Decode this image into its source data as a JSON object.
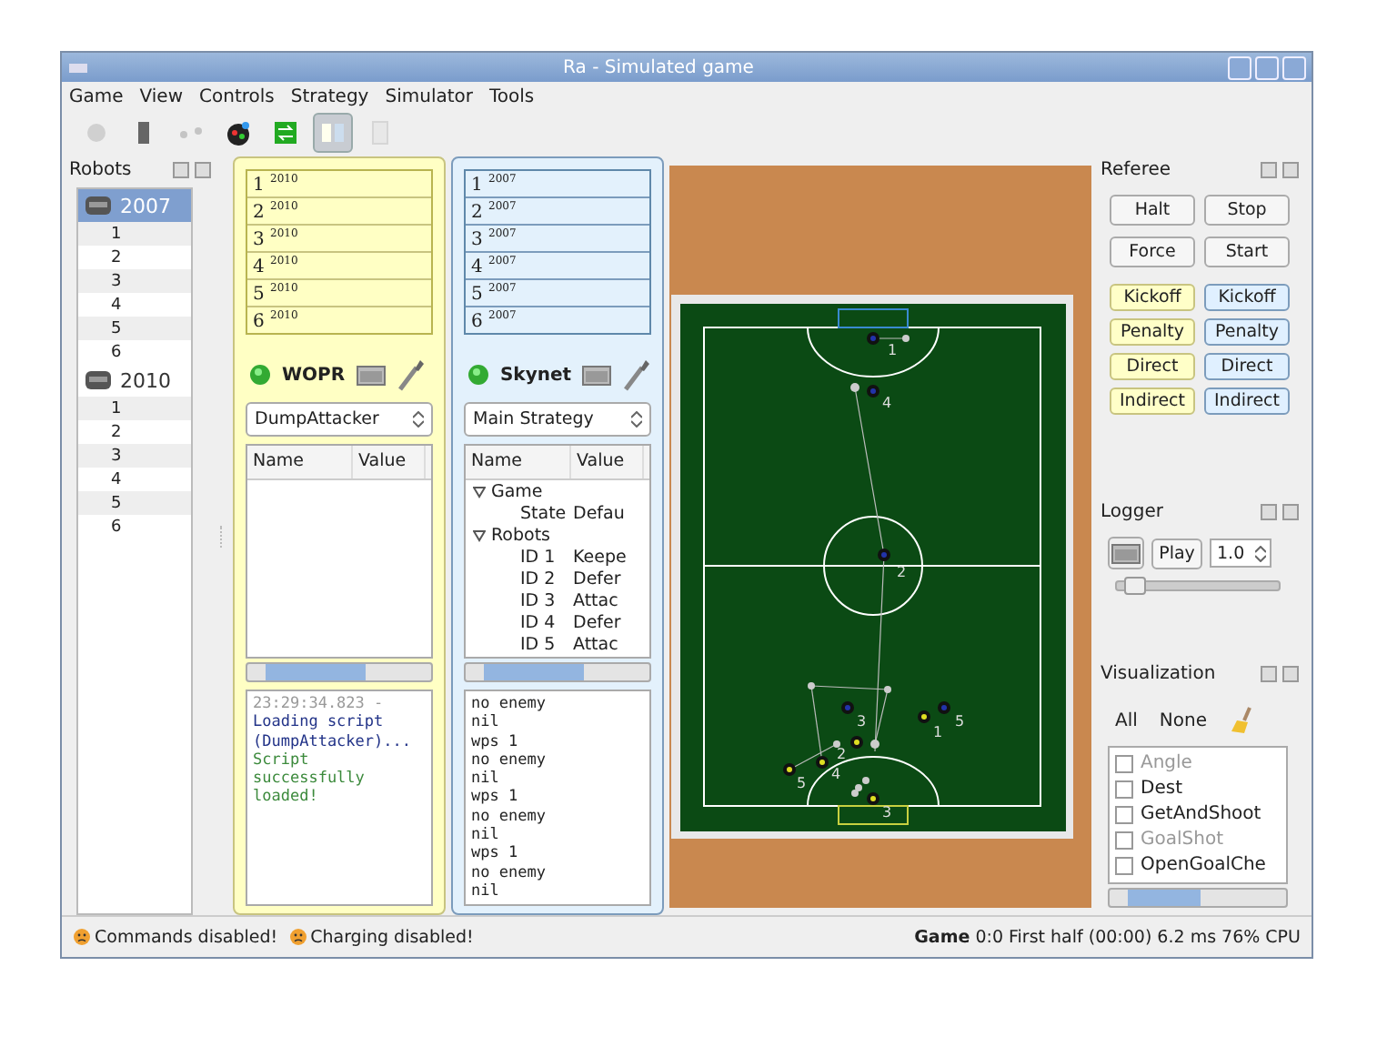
{
  "window": {
    "title": "Ra - Simulated game"
  },
  "menu": [
    {
      "label": "Game"
    },
    {
      "label": "View"
    },
    {
      "label": "Controls"
    },
    {
      "label": "Strategy"
    },
    {
      "label": "Simulator"
    },
    {
      "label": "Tools"
    }
  ],
  "toolbar": [
    {
      "kind": "camera",
      "disabled": true,
      "selected": false
    },
    {
      "kind": "battery",
      "disabled": false,
      "selected": false
    },
    {
      "kind": "network",
      "disabled": true,
      "selected": false
    },
    {
      "kind": "ball",
      "disabled": false,
      "selected": false
    },
    {
      "kind": "swap",
      "disabled": false,
      "selected": false
    },
    {
      "kind": "split",
      "disabled": false,
      "selected": true
    },
    {
      "kind": "page",
      "disabled": true,
      "selected": false
    }
  ],
  "robots_panel": {
    "title": "Robots",
    "groups": [
      {
        "label": "2007",
        "selected": true,
        "robots": [
          "1",
          "2",
          "3",
          "4",
          "5",
          "6"
        ]
      },
      {
        "label": "2010",
        "selected": false,
        "robots": [
          "1",
          "2",
          "3",
          "4",
          "5",
          "6"
        ]
      }
    ]
  },
  "teams": [
    {
      "kind": "yellow",
      "robots": [
        "1 $^{2010}$",
        "2 $^{2010}$",
        "3 $^{2010}$",
        "4 $^{2010}$",
        "5 $^{2010}$",
        "6 $^{2010}$"
      ],
      "name": "WOPR",
      "strategy": "DumpAttacker",
      "columns": [
        "Name",
        "Value"
      ],
      "log": [
        {
          "kind": "time",
          "text": "23:29:34.823 -"
        },
        {
          "kind": "info",
          "text": "Loading script (DumpAttacker)..."
        },
        {
          "kind": "success",
          "text": "Script successfully loaded!"
        }
      ]
    },
    {
      "kind": "blue",
      "robots": [
        "1 $^{2007}$",
        "2 $^{2007}$",
        "3 $^{2007}$",
        "4 $^{2007}$",
        "5 $^{2007}$",
        "6 $^{2007}$"
      ],
      "name": "Skynet",
      "strategy": "Main Strategy",
      "columns": [
        "Name",
        "Value"
      ],
      "tree": [
        {
          "name": "Game",
          "expanded": true,
          "children": [
            {
              "name": "State",
              "value": "Defau"
            }
          ]
        },
        {
          "name": "Robots",
          "expanded": true,
          "children": [
            {
              "name": "ID 1",
              "value": "Keepe"
            },
            {
              "name": "ID 2",
              "value": "Defer"
            },
            {
              "name": "ID 3",
              "value": "Attac"
            },
            {
              "name": "ID 4",
              "value": "Defer"
            },
            {
              "name": "ID 5",
              "value": "Attac"
            }
          ]
        }
      ],
      "log": [
        {
          "kind": "plain",
          "text": "no enemy"
        },
        {
          "kind": "plain",
          "text": "nil"
        },
        {
          "kind": "plain",
          "text": "wps 1"
        },
        {
          "kind": "plain",
          "text": "no enemy"
        },
        {
          "kind": "plain",
          "text": "nil"
        },
        {
          "kind": "plain",
          "text": "wps 1"
        },
        {
          "kind": "plain",
          "text": "no enemy"
        },
        {
          "kind": "plain",
          "text": "nil"
        },
        {
          "kind": "plain",
          "text": "wps 1"
        },
        {
          "kind": "plain",
          "text": "no enemy"
        },
        {
          "kind": "plain",
          "text": "nil"
        }
      ]
    }
  ],
  "field": {
    "robots": [
      {
        "color": "#2233aa",
        "number": "1"
      },
      {
        "color": "#2233aa",
        "number": "4"
      },
      {
        "color": "#2233aa",
        "number": "2"
      },
      {
        "color": "#2233aa",
        "number": "3"
      },
      {
        "color": "#2233aa",
        "number": "5"
      },
      {
        "color": "#dddd22",
        "number": "1"
      },
      {
        "color": "#dddd22",
        "number": "2"
      },
      {
        "color": "#dddd22",
        "number": "4"
      },
      {
        "color": "#dddd22",
        "number": "5"
      },
      {
        "color": "#dddd22",
        "number": "3"
      }
    ]
  },
  "referee": {
    "title": "Referee",
    "buttons": [
      "Halt",
      "Stop",
      "Force",
      "Start"
    ],
    "team_buttons": [
      {
        "label": "Kickoff",
        "color": "#ffffc8"
      },
      {
        "label": "Kickoff",
        "color": "#e0f0ff"
      },
      {
        "label": "Penalty",
        "color": "#ffffc8"
      },
      {
        "label": "Penalty",
        "color": "#e0f0ff"
      },
      {
        "label": "Direct",
        "color": "#ffffc8"
      },
      {
        "label": "Direct",
        "color": "#e0f0ff"
      },
      {
        "label": "Indirect",
        "color": "#ffffc8"
      },
      {
        "label": "Indirect",
        "color": "#e0f0ff"
      }
    ]
  },
  "logger": {
    "title": "Logger",
    "play": "Play",
    "speed": "1.0",
    "level": 0.05
  },
  "visualization": {
    "title": "Visualization",
    "all": "All",
    "none": "None",
    "items": [
      {
        "label": "Angle",
        "checked": false,
        "disabled": true
      },
      {
        "label": "Dest",
        "checked": false,
        "disabled": false
      },
      {
        "label": "GetAndShoot",
        "checked": false,
        "disabled": false
      },
      {
        "label": "GoalShot",
        "checked": false,
        "disabled": true
      },
      {
        "label": "OpenGoalChe",
        "checked": false,
        "disabled": false
      }
    ]
  },
  "status_bar": {
    "messages": [
      "Commands disabled!",
      "Charging disabled!"
    ],
    "game": "**Game** 0:0 First half (00:00) 6.2 ms 76% CPU"
  }
}
